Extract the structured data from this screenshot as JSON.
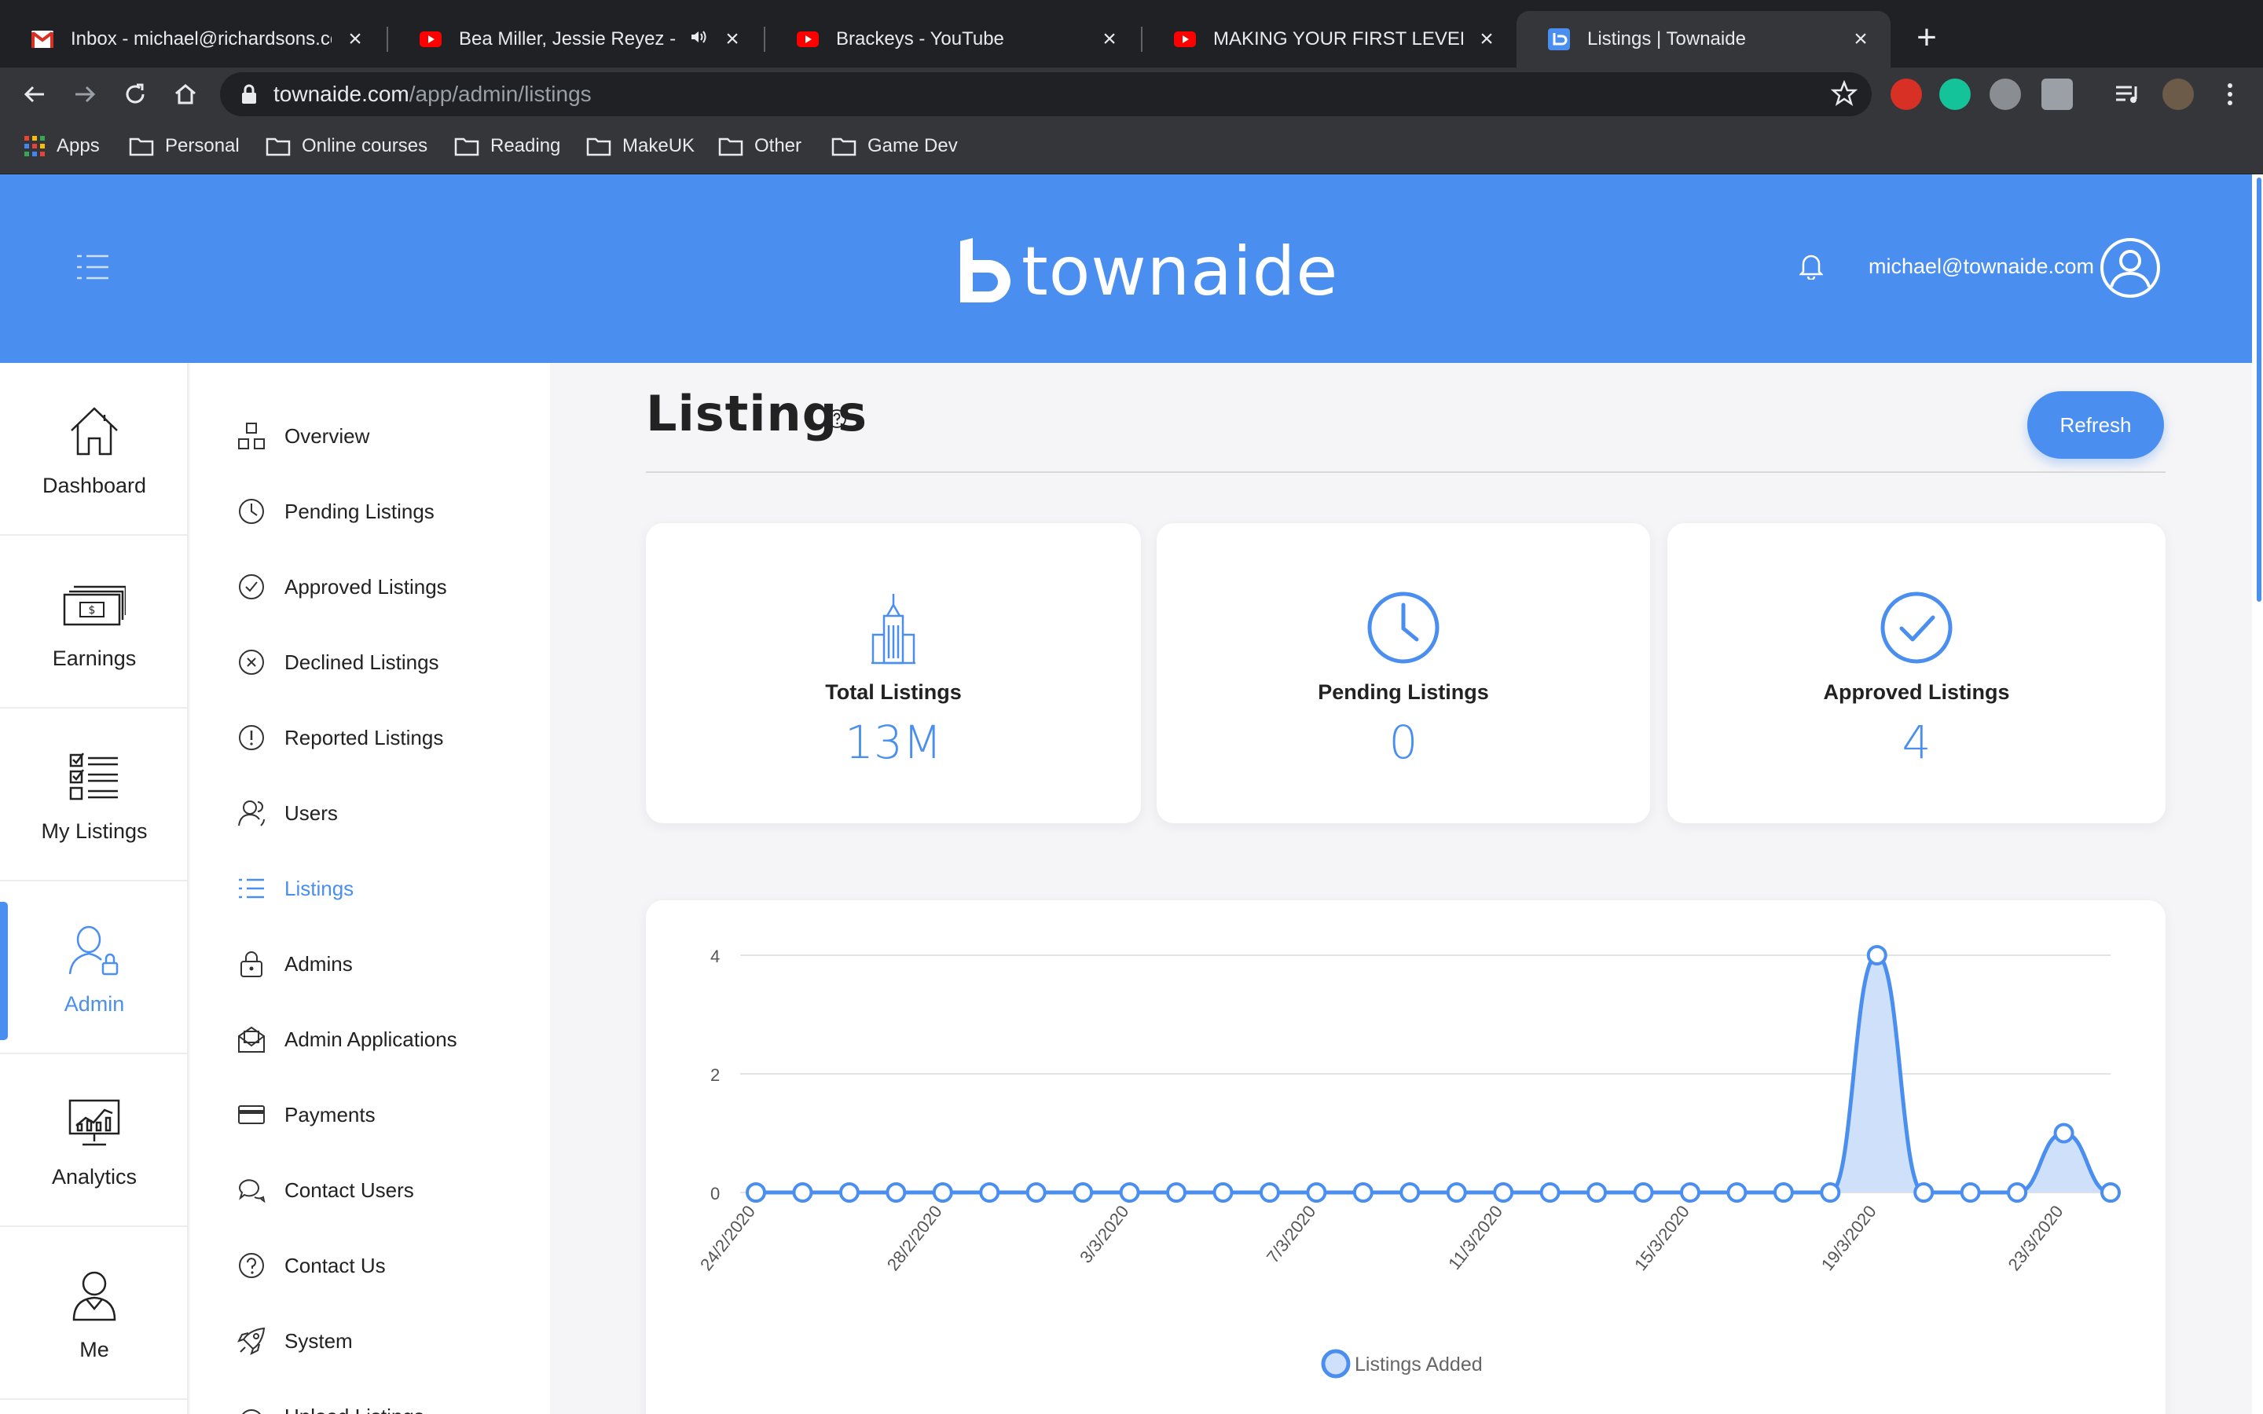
{
  "browser": {
    "tabs": [
      {
        "title": "Inbox - michael@richardsons.co",
        "icon": "gmail-icon"
      },
      {
        "title": "Bea Miller, Jessie Reyez - FE",
        "icon": "youtube-icon",
        "audio": true
      },
      {
        "title": "Brackeys - YouTube",
        "icon": "youtube-icon"
      },
      {
        "title": "MAKING YOUR FIRST LEVEL in U",
        "icon": "youtube-icon"
      },
      {
        "title": "Listings | Townaide",
        "icon": "townaide-icon",
        "active": true
      }
    ],
    "url_domain": "townaide.com",
    "url_path": "/app/admin/listings",
    "bookmarks": [
      "Apps",
      "Personal",
      "Online courses",
      "Reading",
      "MakeUK",
      "Other",
      "Game Dev"
    ]
  },
  "header": {
    "brand": "townaide",
    "user_email": "michael@townaide.com"
  },
  "rail": {
    "items": [
      {
        "label": "Dashboard",
        "icon": "house-icon"
      },
      {
        "label": "Earnings",
        "icon": "banknotes-icon"
      },
      {
        "label": "My Listings",
        "icon": "checklist-icon"
      },
      {
        "label": "Admin",
        "icon": "admin-user-lock-icon",
        "active": true
      },
      {
        "label": "Analytics",
        "icon": "monitor-chart-icon"
      },
      {
        "label": "Me",
        "icon": "person-icon"
      }
    ]
  },
  "submenu": {
    "items": [
      {
        "label": "Overview",
        "icon": "blocks-icon"
      },
      {
        "label": "Pending Listings",
        "icon": "clock-icon"
      },
      {
        "label": "Approved Listings",
        "icon": "check-circle-icon"
      },
      {
        "label": "Declined Listings",
        "icon": "x-circle-icon"
      },
      {
        "label": "Reported Listings",
        "icon": "exclamation-circle-icon"
      },
      {
        "label": "Users",
        "icon": "users-icon"
      },
      {
        "label": "Listings",
        "icon": "list-icon",
        "active": true
      },
      {
        "label": "Admins",
        "icon": "lock-icon"
      },
      {
        "label": "Admin Applications",
        "icon": "envelope-open-icon"
      },
      {
        "label": "Payments",
        "icon": "credit-card-icon"
      },
      {
        "label": "Contact Users",
        "icon": "chat-bubbles-icon"
      },
      {
        "label": "Contact Us",
        "icon": "question-circle-icon"
      },
      {
        "label": "System",
        "icon": "rocket-icon"
      },
      {
        "label": "Upload Listings",
        "icon": "upload-icon"
      }
    ]
  },
  "main": {
    "title": "Listings",
    "refresh_label": "Refresh",
    "cards": [
      {
        "label": "Total Listings",
        "value": "13M",
        "icon": "building-icon"
      },
      {
        "label": "Pending Listings",
        "value": "0",
        "icon": "clock-icon"
      },
      {
        "label": "Approved Listings",
        "value": "4",
        "icon": "check-circle-icon"
      }
    ]
  },
  "colors": {
    "accent": "#4a8ff0",
    "fill": "#cfe0fb"
  },
  "chart_data": {
    "type": "area",
    "title": "",
    "xlabel": "",
    "ylabel": "",
    "ylim": [
      0,
      4
    ],
    "yticks": [
      0,
      2,
      4
    ],
    "grid": true,
    "legend_position": "bottom-center",
    "x": [
      "24/2/2020",
      "25/2/2020",
      "26/2/2020",
      "27/2/2020",
      "28/2/2020",
      "29/2/2020",
      "1/3/2020",
      "2/3/2020",
      "3/3/2020",
      "4/3/2020",
      "5/3/2020",
      "6/3/2020",
      "7/3/2020",
      "8/3/2020",
      "9/3/2020",
      "10/3/2020",
      "11/3/2020",
      "12/3/2020",
      "13/3/2020",
      "14/3/2020",
      "15/3/2020",
      "16/3/2020",
      "17/3/2020",
      "18/3/2020",
      "19/3/2020",
      "20/3/2020",
      "21/3/2020",
      "22/3/2020",
      "23/3/2020",
      "24/3/2020"
    ],
    "xticks": [
      "24/2/2020",
      "28/2/2020",
      "3/3/2020",
      "7/3/2020",
      "11/3/2020",
      "15/3/2020",
      "19/3/2020",
      "23/3/2020"
    ],
    "series": [
      {
        "name": "Listings Added",
        "values": [
          0,
          0,
          0,
          0,
          0,
          0,
          0,
          0,
          0,
          0,
          0,
          0,
          0,
          0,
          0,
          0,
          0,
          0,
          0,
          0,
          0,
          0,
          0,
          0,
          4,
          0,
          0,
          0,
          1,
          0
        ]
      }
    ]
  }
}
